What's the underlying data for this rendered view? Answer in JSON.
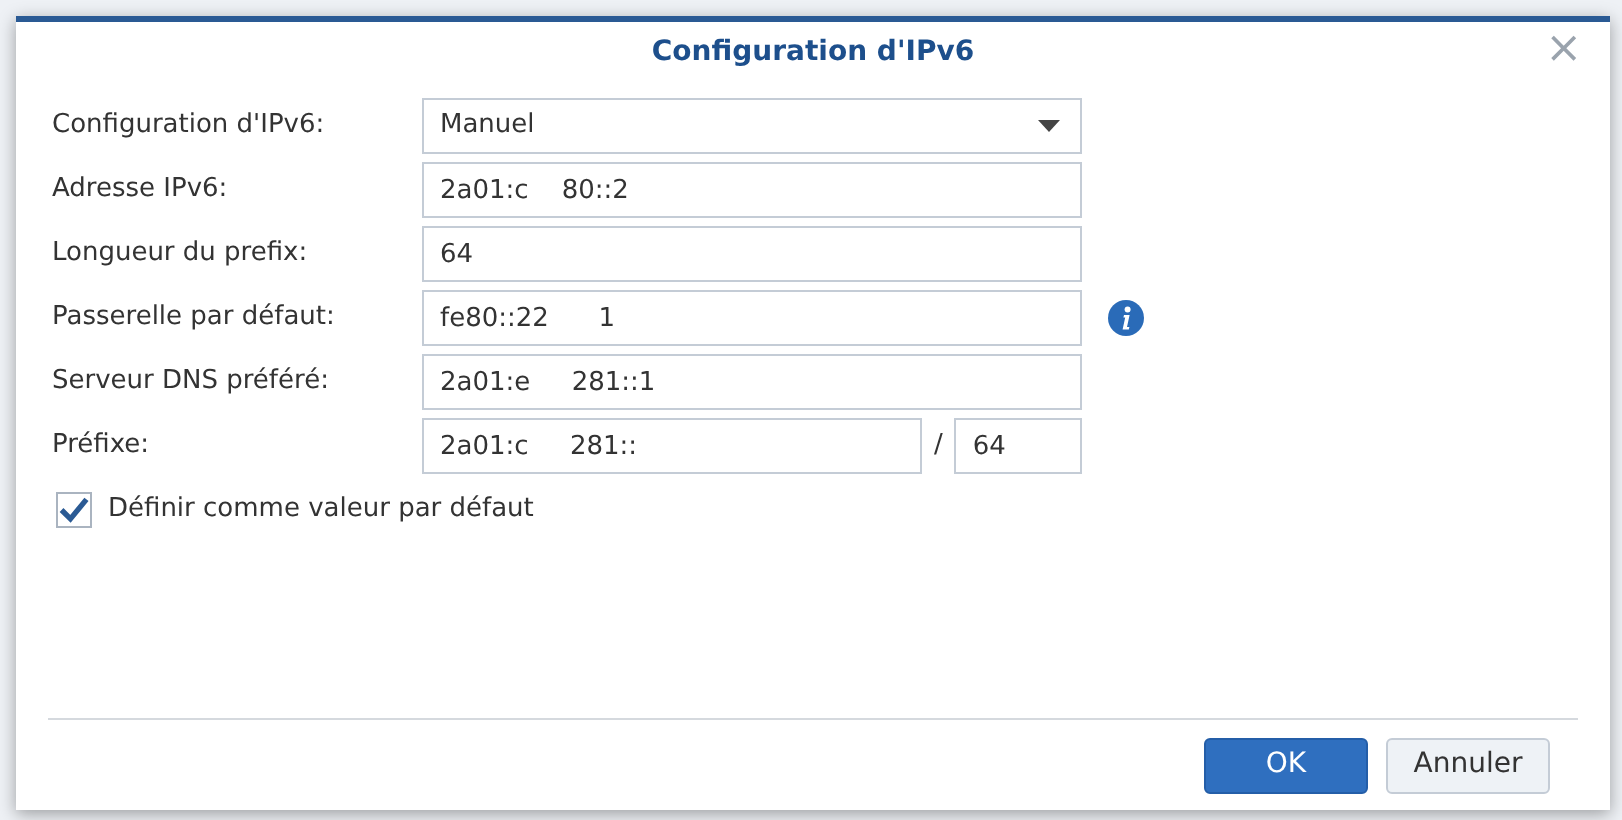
{
  "dialog": {
    "title": "Configuration d'IPv6",
    "close": "×"
  },
  "fields": [
    {
      "kind": "select",
      "label": "Configuration d'IPv6:",
      "value": "Manuel"
    },
    {
      "kind": "text",
      "label": "Adresse IPv6:",
      "value": "2a01:c    80::2"
    },
    {
      "kind": "text",
      "label": "Longueur du prefix:",
      "value": "64"
    },
    {
      "kind": "info",
      "label": "Passerelle par défaut:",
      "value": "fe80::22      1"
    },
    {
      "kind": "text",
      "label": "Serveur DNS préféré:",
      "value": "2a01:e     281::1"
    },
    {
      "kind": "prefix",
      "label": "Préfixe:",
      "value": "2a01:c     281::",
      "separator": "/",
      "length": "64"
    }
  ],
  "default_checkbox": {
    "label": "Définir comme valeur par défaut",
    "checked": true
  },
  "buttons": [
    {
      "label": "OK",
      "kind": "primary"
    },
    {
      "label": "Annuler",
      "kind": "secondary"
    }
  ]
}
